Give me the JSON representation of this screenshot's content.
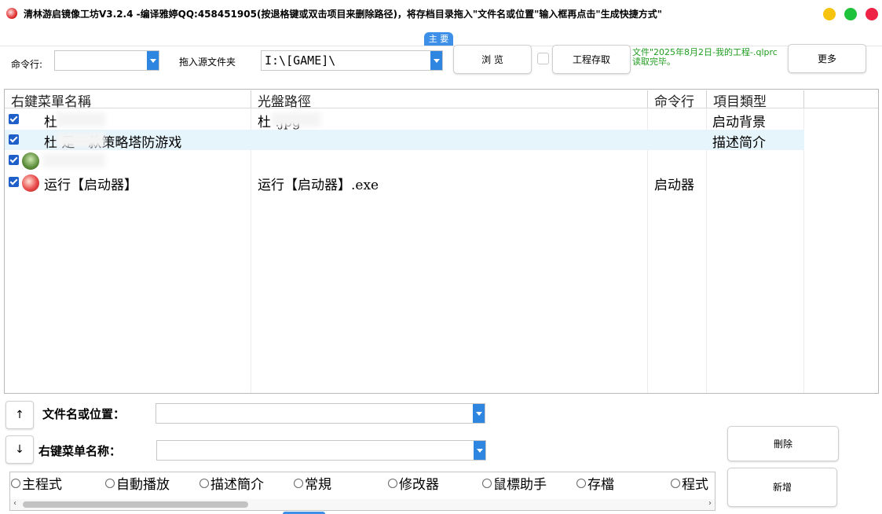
{
  "window": {
    "title": "清林游启镜像工坊V3.2.4 -编译雅婷QQ:458451905(按退格键或双击项目来删除路径)，将存档目录拖入\"文件名或位置\"输入框再点击\"生成快捷方式\"",
    "icon": "red-sphere-app-icon",
    "controls": {
      "minimize_color": "#f6c40e",
      "maximize_color": "#1ec33b",
      "close_color": "#ee2244"
    }
  },
  "tab": {
    "label": "主 要",
    "color": "#3d8fe8"
  },
  "toolbar": {
    "command_label": "命令行:",
    "command_value": "",
    "source_label": "拖入源文件夹",
    "source_value": "I:\\[GAME]\\",
    "browse_label": "浏 览",
    "project_checkbox_checked": false,
    "project_label": "工程存取",
    "status_line1": "文件\"2025年8月2日-我的工程-.qlprc",
    "status_line2": "读取完毕。",
    "more_label": "更多"
  },
  "list": {
    "headers": [
      "右鍵菜單名稱",
      "光盤路徑",
      "命令行",
      "項目類型"
    ],
    "rows": [
      {
        "checked": true,
        "icon": "",
        "name": "杜",
        "path": "杜              .jpg",
        "cmd": "",
        "type": "启动背景",
        "selected": false
      },
      {
        "checked": true,
        "icon": "",
        "name": "杜          是一款策略塔防游戏",
        "path": "",
        "cmd": "",
        "type": "描述简介",
        "selected": true
      },
      {
        "checked": true,
        "icon": "plant-game-icon",
        "name": "",
        "path": "",
        "cmd": "",
        "type": "",
        "selected": false
      },
      {
        "checked": true,
        "icon": "launcher-game-icon",
        "name": "运行【启动器】",
        "path": "运行【启动器】.exe",
        "cmd": "启动器",
        "type": "",
        "selected": false
      }
    ],
    "selected_row_color": "#e6f4fb",
    "checkbox_color": "#1f5fc9"
  },
  "bottom": {
    "up_label": "↑",
    "down_label": "↓",
    "filename_label": "文件名或位置：",
    "filename_value": "",
    "menuname_label": "右键菜单名称：",
    "menuname_value": "",
    "delete_label": "刪除",
    "add_label": "新增",
    "radios": [
      "主程式",
      "自動播放",
      "描述簡介",
      "常規",
      "修改器",
      "鼠標助手",
      "存檔",
      "程式"
    ]
  }
}
